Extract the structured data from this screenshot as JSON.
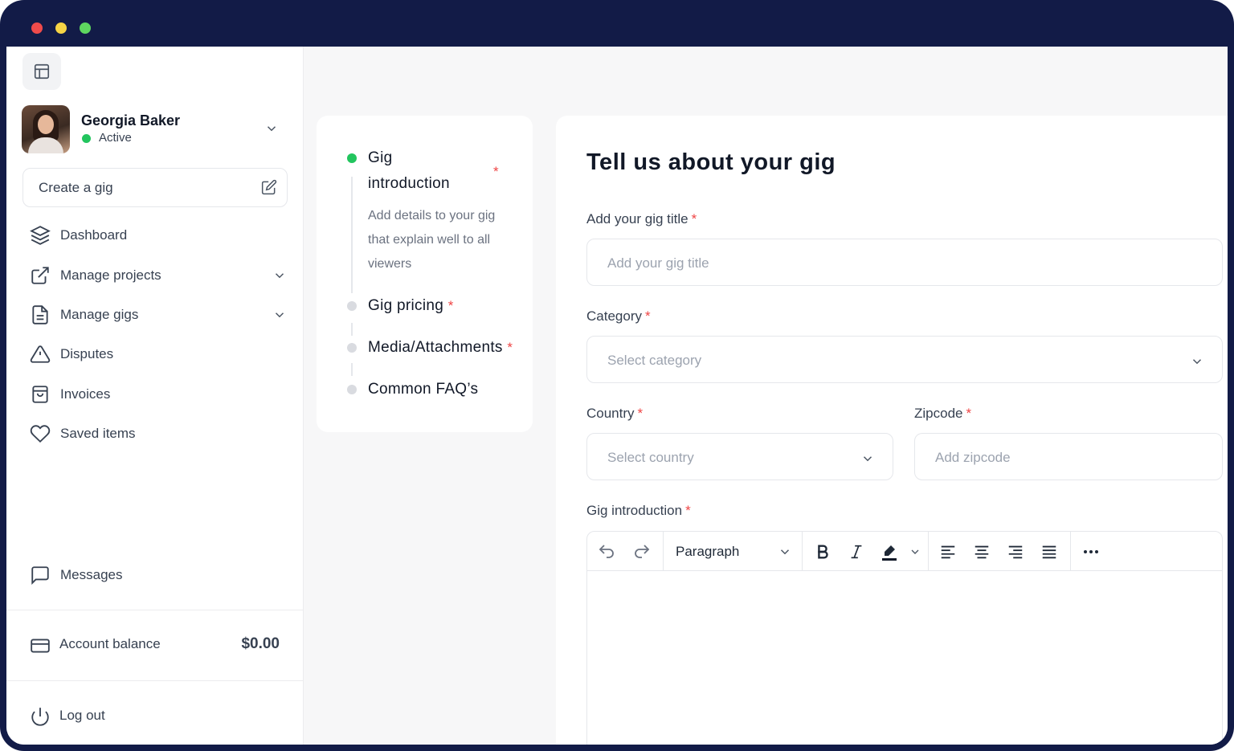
{
  "sidebar": {
    "profile": {
      "name": "Georgia Baker",
      "status": "Active"
    },
    "create_gig_label": "Create a gig",
    "nav": [
      {
        "label": "Dashboard",
        "icon": "layers-icon"
      },
      {
        "label": "Manage projects",
        "icon": "external-link-icon"
      },
      {
        "label": "Manage gigs",
        "icon": "document-icon"
      },
      {
        "label": "Disputes",
        "icon": "warning-icon"
      },
      {
        "label": "Invoices",
        "icon": "shopping-bag-icon"
      },
      {
        "label": "Saved items",
        "icon": "heart-icon"
      }
    ],
    "messages_label": "Messages",
    "account_balance": {
      "label": "Account balance",
      "value": "$0.00"
    },
    "logout_label": "Log out"
  },
  "steps": {
    "items": [
      {
        "title_line1": "Gig",
        "title_line2": "introduction",
        "required": "*",
        "description": "Add details to your gig that explain well to all viewers",
        "active": true
      },
      {
        "title": "Gig pricing",
        "required": "*"
      },
      {
        "title": "Media/Attachments",
        "required": "*"
      },
      {
        "title": "Common FAQ’s"
      }
    ]
  },
  "form": {
    "title": "Tell us about your gig",
    "required_mark": "*",
    "gig_title": {
      "label": "Add your gig title",
      "placeholder": "Add your gig title"
    },
    "category": {
      "label": "Category",
      "placeholder": "Select category"
    },
    "country": {
      "label": "Country",
      "placeholder": "Select country"
    },
    "zipcode": {
      "label": "Zipcode",
      "placeholder": "Add zipcode"
    },
    "introduction": {
      "label": "Gig introduction",
      "block_style": "Paragraph"
    }
  },
  "colors": {
    "window_frame": "#121b47",
    "active_status": "#22c55e",
    "required": "#ef4444"
  }
}
